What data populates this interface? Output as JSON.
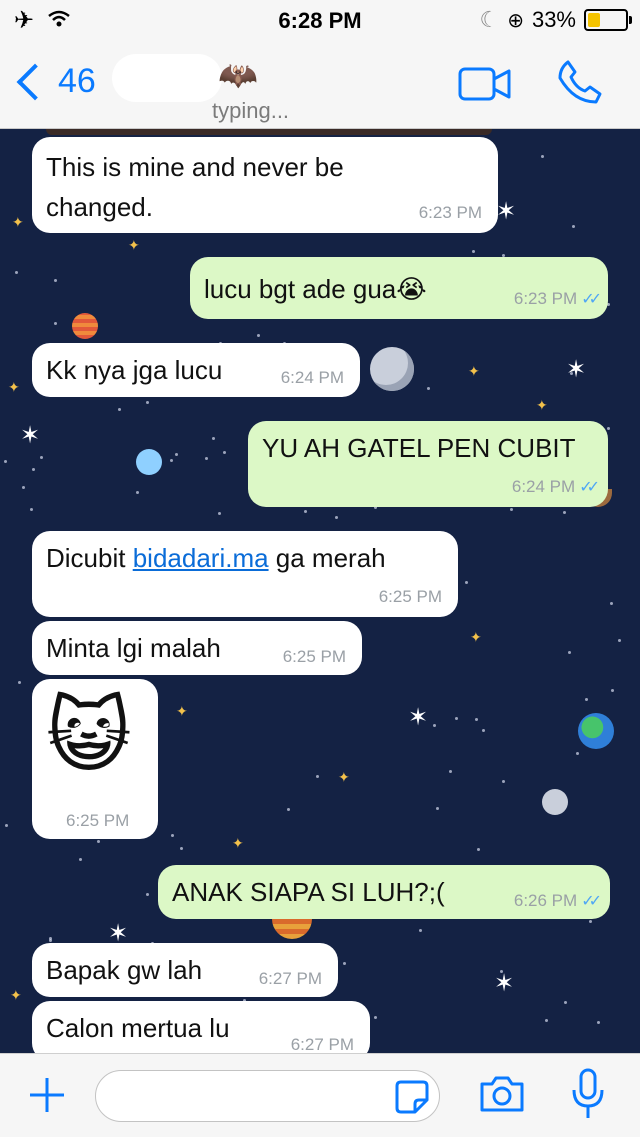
{
  "status": {
    "time": "6:28 PM",
    "battery": "33%",
    "battery_level": 0.33
  },
  "nav": {
    "back_count": "46",
    "subtitle": "typing..."
  },
  "messages": [
    {
      "dir": "in",
      "text": "This is mine and never be changed.",
      "time": "6:23 PM"
    },
    {
      "dir": "out",
      "text": "lucu bgt ade gua😭",
      "time": "6:23 PM"
    },
    {
      "dir": "in",
      "text": "Kk nya jga lucu",
      "time": "6:24 PM"
    },
    {
      "dir": "out",
      "text": "YU AH GATEL PEN CUBIT",
      "time": "6:24 PM"
    },
    {
      "dir": "in",
      "text_prefix": "Dicubit ",
      "link": "bidadari.ma",
      "text_suffix": " ga merah",
      "time": "6:25 PM"
    },
    {
      "dir": "in",
      "text": "Minta lgi malah",
      "time": "6:25 PM"
    },
    {
      "dir": "in",
      "emoji": "😺",
      "time": "6:25 PM"
    },
    {
      "dir": "out",
      "text": "ANAK SIAPA SI LUH?;(",
      "time": "6:26 PM"
    },
    {
      "dir": "in",
      "text": "Bapak gw lah",
      "time": "6:27 PM"
    },
    {
      "dir": "in",
      "text": "Calon mertua lu",
      "time": "6:27 PM"
    }
  ],
  "icons": [
    "airplane-icon",
    "wifi-icon",
    "moon-icon",
    "rotation-lock-icon",
    "battery-icon",
    "video-call-icon",
    "phone-icon",
    "plus-icon",
    "sticker-icon",
    "camera-icon",
    "microphone-icon"
  ],
  "colors": {
    "accent": "#0a7aff",
    "outgoing": "#dcf8c6",
    "incoming": "#ffffff",
    "read_tick": "#4fa6f5",
    "wallpaper": "#142244"
  }
}
